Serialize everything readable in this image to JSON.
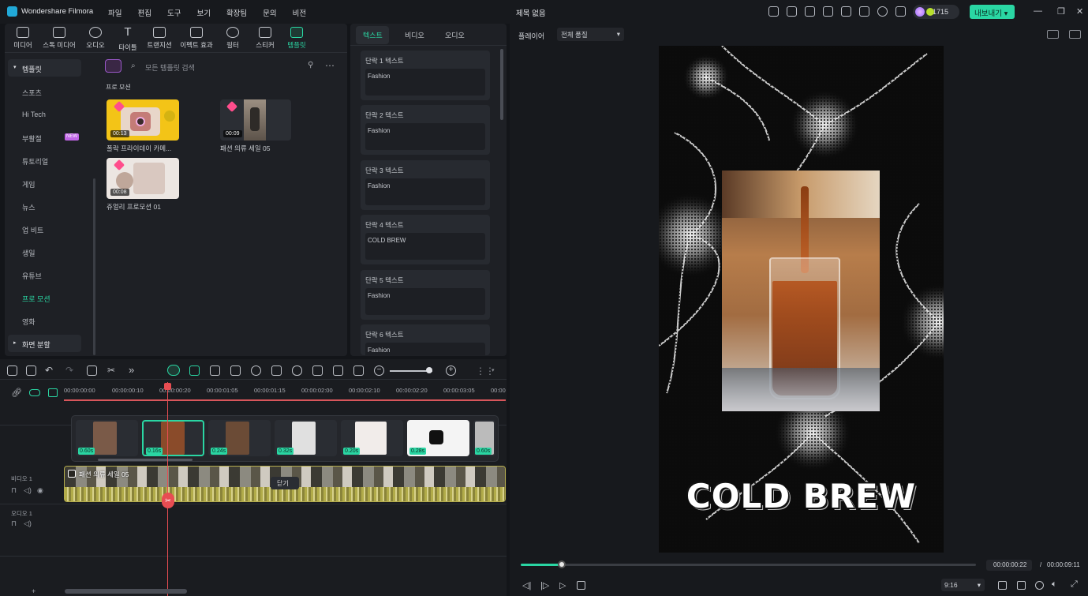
{
  "app": {
    "name": "Wondershare Filmora",
    "project_title": "제목 없음",
    "credits": "1715",
    "export_label": "내보내기"
  },
  "menu": [
    "파일",
    "편집",
    "도구",
    "보기",
    "확장팀",
    "문의",
    "비전"
  ],
  "media_tabs": [
    {
      "label": "미디어"
    },
    {
      "label": "스톡 미디어"
    },
    {
      "label": "오디오"
    },
    {
      "label": "타이틀"
    },
    {
      "label": "트랜지션"
    },
    {
      "label": "이펙트 효과"
    },
    {
      "label": "필터"
    },
    {
      "label": "스티커"
    },
    {
      "label": "템플릿"
    }
  ],
  "sidebar": {
    "header": "템플릿",
    "items": [
      "스포츠",
      "Hi Tech",
      "부활절",
      "튜토리얼",
      "게임",
      "뉴스",
      "업 비트",
      "생일",
      "유튜브",
      "프로 모션",
      "영화"
    ],
    "footer": "화면 분할",
    "new_badge": "NEW",
    "active": "프로 모션"
  },
  "search": {
    "placeholder": "모든 템플릿 검색"
  },
  "section_title": "프로 모션",
  "templates": [
    {
      "name": "폴락 프라이데이 카메...",
      "duration": "00:13"
    },
    {
      "name": "패션 의류 세일 05",
      "duration": "00:09"
    },
    {
      "name": "쥬얼리 프로모션 01",
      "duration": "00:08"
    }
  ],
  "right_tabs": [
    "텍스트",
    "비디오",
    "오디오"
  ],
  "text_fields": [
    {
      "label": "단락 1 텍스트",
      "value": "Fashion"
    },
    {
      "label": "단락 2 텍스트",
      "value": "Fashion"
    },
    {
      "label": "단락 3 텍스트",
      "value": "Fashion"
    },
    {
      "label": "단락 4 텍스트",
      "value": "COLD BREW"
    },
    {
      "label": "단락 5 텍스트",
      "value": "Fashion"
    },
    {
      "label": "단락 6 텍스트",
      "value": "Fashion"
    }
  ],
  "player": {
    "label": "플레이어",
    "quality": "전체 품질",
    "overlay_text": "COLD BREW",
    "current_time": "00:00:00:22",
    "total_time": "00:00:09:11",
    "ratio": "9:16",
    "progress": 0.09
  },
  "ruler": [
    "00:00:00:00",
    "00:00:00:10",
    "00:00:00:20",
    "00:00:01:05",
    "00:00:01:15",
    "00:00:02:00",
    "00:00:02:10",
    "00:00:02:20",
    "00:00:03:05",
    "00:00"
  ],
  "clips": [
    {
      "dur": "0.60s"
    },
    {
      "dur": "0.16s"
    },
    {
      "dur": "0.24s"
    },
    {
      "dur": "0.32s"
    },
    {
      "dur": "0.20s"
    },
    {
      "dur": "0.28s"
    },
    {
      "dur": "0.60s"
    }
  ],
  "tracks": {
    "video1": "비디오 1",
    "audio1": "오디오 1",
    "clip_label": "패션 의류 세일 05",
    "tooltip": "닫기"
  }
}
